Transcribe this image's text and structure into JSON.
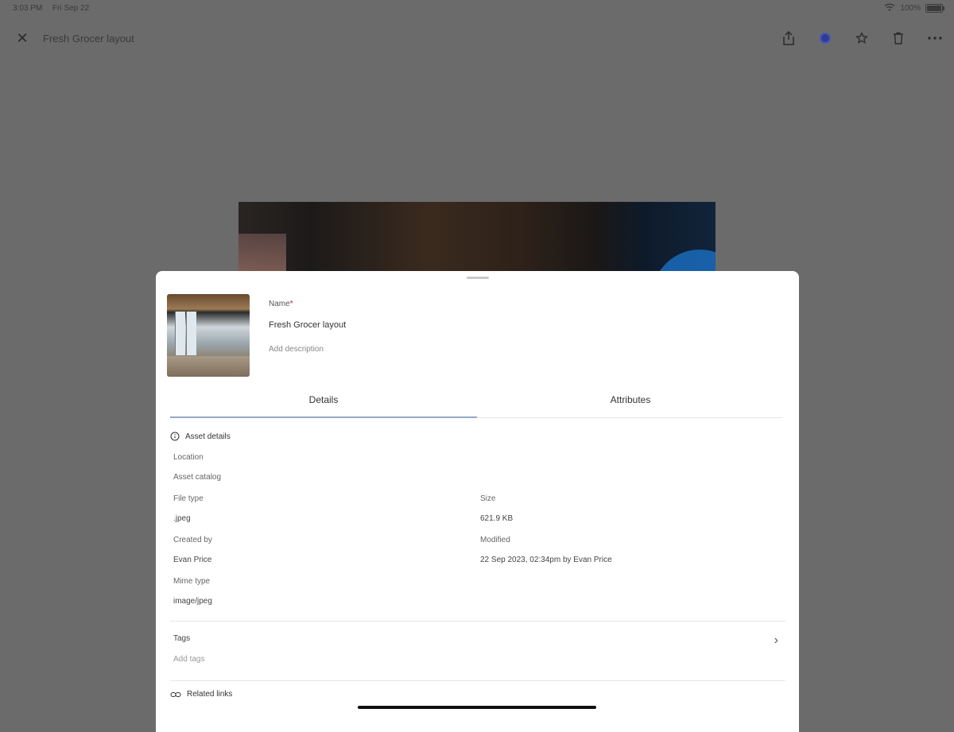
{
  "status": {
    "time": "3:03 PM",
    "date": "Fri Sep 22",
    "battery": "100%"
  },
  "header": {
    "title": "Fresh Grocer layout"
  },
  "asset": {
    "name_label": "Name",
    "name_required": "*",
    "name_value": "Fresh Grocer layout",
    "description_placeholder": "Add description"
  },
  "tabs": [
    {
      "label": "Details",
      "active": true
    },
    {
      "label": "Attributes",
      "active": false
    }
  ],
  "details": {
    "section_title": "Asset details",
    "location_label": "Location",
    "catalog_label": "Asset catalog",
    "file_type_label": "File type",
    "file_type_value": ".jpeg",
    "size_label": "Size",
    "size_value": "621.9 KB",
    "created_by_label": "Created by",
    "created_by_value": "Evan Price",
    "modified_label": "Modified",
    "modified_value": "22 Sep 2023, 02:34pm by Evan Price",
    "mime_label": "Mime type",
    "mime_value": "image/jpeg",
    "tags_label": "Tags",
    "tags_placeholder": "Add tags",
    "related_links_label": "Related links"
  },
  "colors": {
    "accent_tab": "#93a9c8",
    "avatar": "#2f3c96",
    "required": "#c8102e"
  }
}
